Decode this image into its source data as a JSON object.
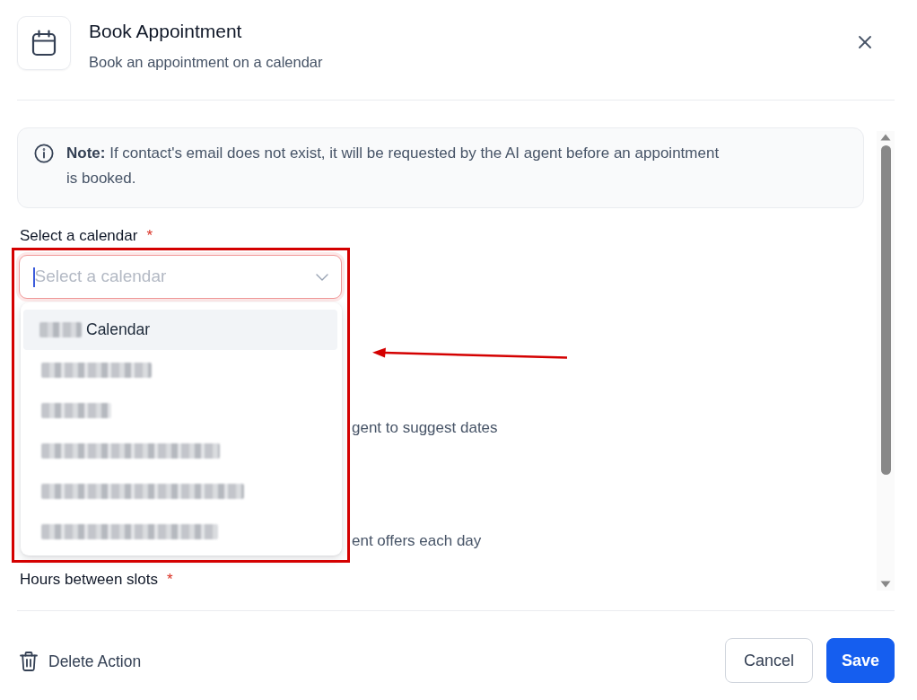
{
  "dialog": {
    "title": "Book Appointment",
    "subtitle": "Book an appointment on a calendar"
  },
  "note": {
    "text": "**Note:** If contact's email does not exist, it will be requested by the AI agent before an appointment is booked."
  },
  "calendar_select": {
    "label": "Select a calendar",
    "required_mark": "*",
    "placeholder": "Select a calendar",
    "focused": true,
    "open": true,
    "options": [
      {
        "kind": "partly_blurred",
        "label": "Calendar",
        "selected": true
      },
      {
        "kind": "blurred",
        "selected": false
      },
      {
        "kind": "blurred",
        "selected": false
      },
      {
        "kind": "blurred",
        "selected": false
      },
      {
        "kind": "blurred",
        "selected": false
      },
      {
        "kind": "blurred",
        "selected": false
      }
    ]
  },
  "hidden_fields": [
    {
      "kind": "hint",
      "text": "gent to suggest dates"
    },
    {
      "kind": "hint",
      "text": "ent offers each day"
    },
    {
      "kind": "label",
      "label": "Hours between slots",
      "required_mark": "*"
    }
  ],
  "footer": {
    "delete_label": "Delete Action",
    "buttons": [
      {
        "kind": "secondary",
        "label": "Cancel"
      },
      {
        "kind": "primary",
        "label": "Save"
      }
    ]
  },
  "annotations": {
    "highlight_box": true,
    "arrow": true
  }
}
